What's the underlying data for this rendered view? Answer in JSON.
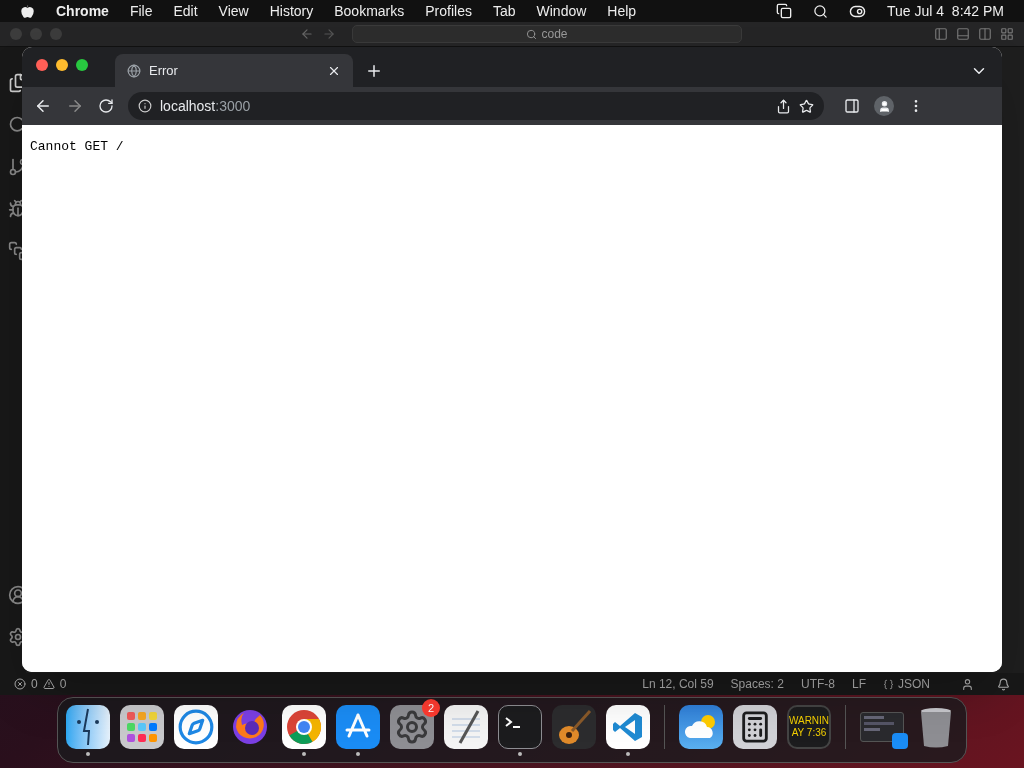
{
  "menu_bar": {
    "app_name": "Chrome",
    "items": [
      "File",
      "Edit",
      "View",
      "History",
      "Bookmarks",
      "Profiles",
      "Tab",
      "Window",
      "Help"
    ],
    "date": "Tue Jul 4",
    "time": "8:42 PM"
  },
  "editor": {
    "search": "code",
    "status_bar": {
      "errors": "0",
      "warnings": "0",
      "items": [
        "Ln 12, Col 59",
        "Spaces: 2",
        "UTF-8",
        "LF",
        "JSON"
      ]
    }
  },
  "browser": {
    "tabs": [
      {
        "title": "Error",
        "selected": true
      }
    ],
    "url_host": "localhost",
    "url_port": ":3000",
    "page_text": "Cannot GET /"
  },
  "dock": {
    "apps": [
      {
        "kind": "finder",
        "running": true
      },
      {
        "kind": "launchpad",
        "running": false
      },
      {
        "kind": "safari",
        "running": false
      },
      {
        "kind": "firefox",
        "running": false
      },
      {
        "kind": "chrome",
        "running": true
      },
      {
        "kind": "appstore",
        "running": true
      },
      {
        "kind": "settings",
        "running": false,
        "badge": "2"
      },
      {
        "kind": "textedit",
        "running": false
      },
      {
        "kind": "terminal",
        "running": true
      },
      {
        "kind": "guitar",
        "running": false
      },
      {
        "kind": "vscode",
        "running": true
      },
      {
        "kind": "divider"
      },
      {
        "kind": "weather",
        "running": false
      },
      {
        "kind": "calculator",
        "running": false
      },
      {
        "kind": "console",
        "running": false,
        "lines": [
          "WARNIN",
          "AY 7:36"
        ]
      },
      {
        "kind": "divider"
      },
      {
        "kind": "window",
        "running": false
      },
      {
        "kind": "trash",
        "running": false
      }
    ]
  }
}
